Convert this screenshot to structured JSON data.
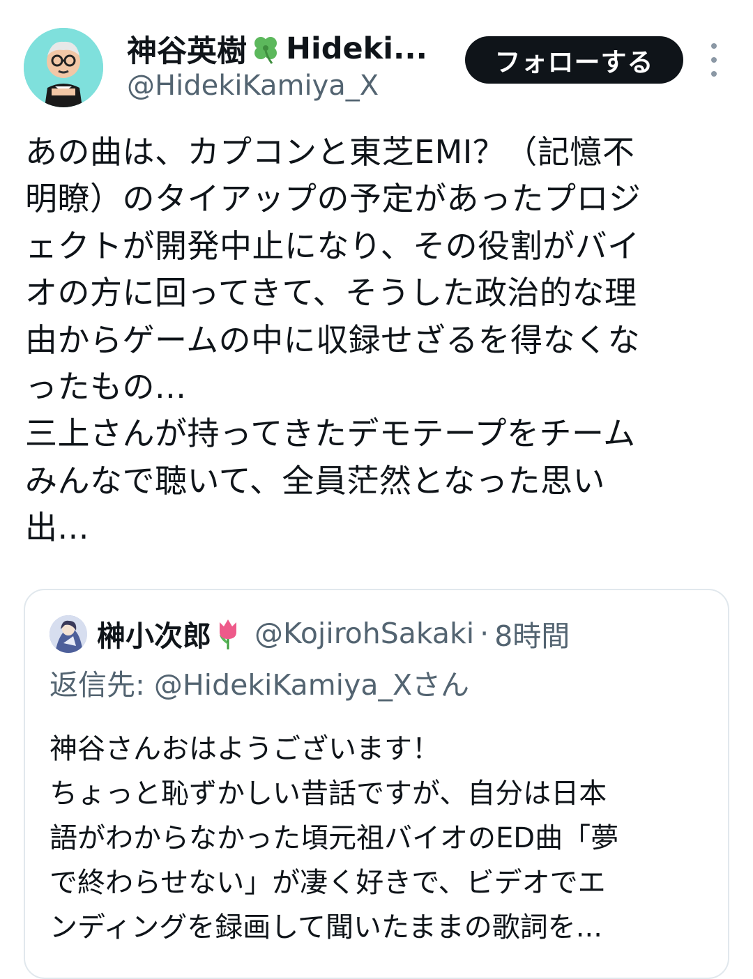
{
  "author": {
    "display_name": "神谷英樹",
    "display_name_suffix": "Hideki...",
    "handle": "@HidekiKamiya_X"
  },
  "follow_button_label": "フォローする",
  "tweet_text": "あの曲は、カプコンと東芝EMI？（記憶不\n明瞭）のタイアップの予定があったプロジ\nェクトが開発中止になり、その役割がバイ\nオの方に回ってきて、そうした政治的な理\n由からゲームの中に収録せざるを得なくな\nったもの...\n三上さんが持ってきたデモテープをチーム\nみんなで聴いて、全員茫然となった思い\n出...",
  "quoted_tweet": {
    "display_name": "榊小次郎",
    "handle": "@KojirohSakaki",
    "separator": "·",
    "timestamp": "8時間",
    "reply_to": "返信先: @HidekiKamiya_Xさん",
    "text": "神谷さんおはようございます！\nちょっと恥ずかしい昔話ですが、自分は日本\n語がわからなかった頃元祖バイオのED曲「夢\nで終わらせない」が凄く好きで、ビデオでエ\nンディングを録画して聞いたままの歌詞を..."
  },
  "colors": {
    "follow_button_bg": "#0f1419",
    "secondary_text": "#536471",
    "avatar_bg": "#7fe0dc"
  },
  "icons": [
    "avatar-cartoon",
    "four-leaf-clover-icon",
    "more-options-icon",
    "tulip-icon"
  ]
}
